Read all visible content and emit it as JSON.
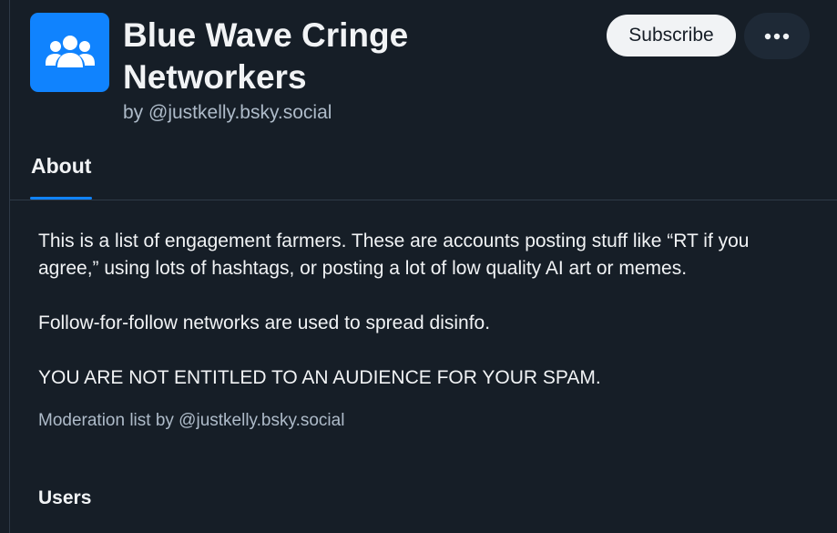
{
  "list": {
    "title": "Blue Wave Cringe Networkers",
    "byline": "by @justkelly.bsky.social",
    "avatar_icon": "people-group-icon"
  },
  "actions": {
    "subscribe_label": "Subscribe",
    "more_icon": "more-horizontal-icon"
  },
  "tabs": [
    {
      "label": "About",
      "active": true
    }
  ],
  "about": {
    "paragraphs": [
      "This is a list of engagement farmers. These are accounts posting stuff like “RT if you agree,” using lots of hashtags, or posting a lot of low quality AI art or memes.",
      "Follow-for-follow networks are used to spread disinfo.",
      "YOU ARE NOT ENTITLED TO AN AUDIENCE FOR YOUR SPAM."
    ],
    "moderation_line": "Moderation list by @justkelly.bsky.social"
  },
  "sections": {
    "users_title": "Users"
  },
  "colors": {
    "background": "#161e27",
    "accent": "#1083fe",
    "text": "#f1f3f5",
    "muted_text": "#aebbc9",
    "border": "#2e3a47"
  }
}
